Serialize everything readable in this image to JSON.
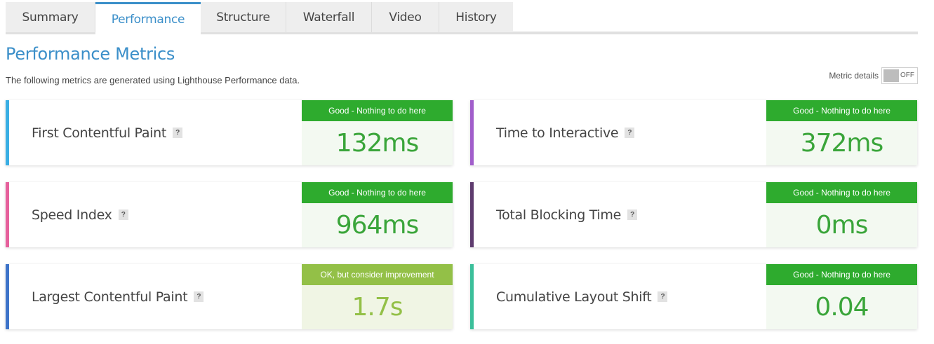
{
  "tabs": [
    {
      "label": "Summary",
      "active": false
    },
    {
      "label": "Performance",
      "active": true
    },
    {
      "label": "Structure",
      "active": false
    },
    {
      "label": "Waterfall",
      "active": false
    },
    {
      "label": "Video",
      "active": false
    },
    {
      "label": "History",
      "active": false
    }
  ],
  "header": {
    "title": "Performance Metrics",
    "description": "The following metrics are generated using Lighthouse Performance data."
  },
  "metric_details": {
    "label": "Metric details",
    "toggle_state": "OFF"
  },
  "help_glyph": "?",
  "colors": {
    "accent": "#3b8fc9",
    "good_badge": "#2eab2e",
    "good_value_bg": "#f3f9f1",
    "good_value_text": "#3aa53a",
    "ok_badge": "#93c047",
    "ok_value_bg": "#f0f5e4",
    "ok_value_text": "#93c047"
  },
  "metrics": [
    {
      "name": "First Contentful Paint",
      "status": "Good - Nothing to do here",
      "value": "132ms",
      "grade": "good",
      "stripe_color": "#39aee4"
    },
    {
      "name": "Time to Interactive",
      "status": "Good - Nothing to do here",
      "value": "372ms",
      "grade": "good",
      "stripe_color": "#a15ecb"
    },
    {
      "name": "Speed Index",
      "status": "Good - Nothing to do here",
      "value": "964ms",
      "grade": "good",
      "stripe_color": "#e6609c"
    },
    {
      "name": "Total Blocking Time",
      "status": "Good - Nothing to do here",
      "value": "0ms",
      "grade": "good",
      "stripe_color": "#5e3b6e"
    },
    {
      "name": "Largest Contentful Paint",
      "status": "OK, but consider improvement",
      "value": "1.7s",
      "grade": "ok",
      "stripe_color": "#3d73c9"
    },
    {
      "name": "Cumulative Layout Shift",
      "status": "Good - Nothing to do here",
      "value": "0.04",
      "grade": "good",
      "stripe_color": "#3bbf9a"
    }
  ]
}
